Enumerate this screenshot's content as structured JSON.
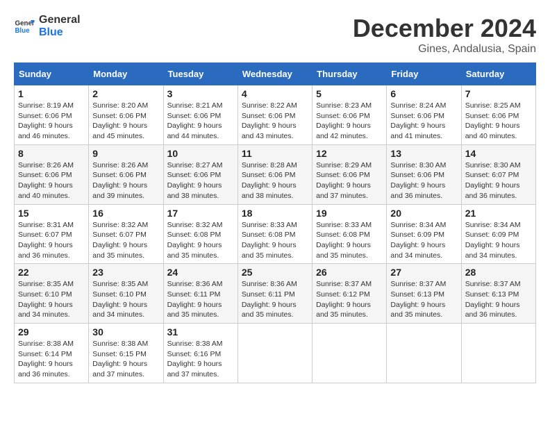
{
  "logo": {
    "line1": "General",
    "line2": "Blue"
  },
  "title": "December 2024",
  "subtitle": "Gines, Andalusia, Spain",
  "days_header": [
    "Sunday",
    "Monday",
    "Tuesday",
    "Wednesday",
    "Thursday",
    "Friday",
    "Saturday"
  ],
  "weeks": [
    [
      {
        "num": "1",
        "info": "Sunrise: 8:19 AM\nSunset: 6:06 PM\nDaylight: 9 hours\nand 46 minutes."
      },
      {
        "num": "2",
        "info": "Sunrise: 8:20 AM\nSunset: 6:06 PM\nDaylight: 9 hours\nand 45 minutes."
      },
      {
        "num": "3",
        "info": "Sunrise: 8:21 AM\nSunset: 6:06 PM\nDaylight: 9 hours\nand 44 minutes."
      },
      {
        "num": "4",
        "info": "Sunrise: 8:22 AM\nSunset: 6:06 PM\nDaylight: 9 hours\nand 43 minutes."
      },
      {
        "num": "5",
        "info": "Sunrise: 8:23 AM\nSunset: 6:06 PM\nDaylight: 9 hours\nand 42 minutes."
      },
      {
        "num": "6",
        "info": "Sunrise: 8:24 AM\nSunset: 6:06 PM\nDaylight: 9 hours\nand 41 minutes."
      },
      {
        "num": "7",
        "info": "Sunrise: 8:25 AM\nSunset: 6:06 PM\nDaylight: 9 hours\nand 40 minutes."
      }
    ],
    [
      {
        "num": "8",
        "info": "Sunrise: 8:26 AM\nSunset: 6:06 PM\nDaylight: 9 hours\nand 40 minutes."
      },
      {
        "num": "9",
        "info": "Sunrise: 8:26 AM\nSunset: 6:06 PM\nDaylight: 9 hours\nand 39 minutes."
      },
      {
        "num": "10",
        "info": "Sunrise: 8:27 AM\nSunset: 6:06 PM\nDaylight: 9 hours\nand 38 minutes."
      },
      {
        "num": "11",
        "info": "Sunrise: 8:28 AM\nSunset: 6:06 PM\nDaylight: 9 hours\nand 38 minutes."
      },
      {
        "num": "12",
        "info": "Sunrise: 8:29 AM\nSunset: 6:06 PM\nDaylight: 9 hours\nand 37 minutes."
      },
      {
        "num": "13",
        "info": "Sunrise: 8:30 AM\nSunset: 6:06 PM\nDaylight: 9 hours\nand 36 minutes."
      },
      {
        "num": "14",
        "info": "Sunrise: 8:30 AM\nSunset: 6:07 PM\nDaylight: 9 hours\nand 36 minutes."
      }
    ],
    [
      {
        "num": "15",
        "info": "Sunrise: 8:31 AM\nSunset: 6:07 PM\nDaylight: 9 hours\nand 36 minutes."
      },
      {
        "num": "16",
        "info": "Sunrise: 8:32 AM\nSunset: 6:07 PM\nDaylight: 9 hours\nand 35 minutes."
      },
      {
        "num": "17",
        "info": "Sunrise: 8:32 AM\nSunset: 6:08 PM\nDaylight: 9 hours\nand 35 minutes."
      },
      {
        "num": "18",
        "info": "Sunrise: 8:33 AM\nSunset: 6:08 PM\nDaylight: 9 hours\nand 35 minutes."
      },
      {
        "num": "19",
        "info": "Sunrise: 8:33 AM\nSunset: 6:08 PM\nDaylight: 9 hours\nand 35 minutes."
      },
      {
        "num": "20",
        "info": "Sunrise: 8:34 AM\nSunset: 6:09 PM\nDaylight: 9 hours\nand 34 minutes."
      },
      {
        "num": "21",
        "info": "Sunrise: 8:34 AM\nSunset: 6:09 PM\nDaylight: 9 hours\nand 34 minutes."
      }
    ],
    [
      {
        "num": "22",
        "info": "Sunrise: 8:35 AM\nSunset: 6:10 PM\nDaylight: 9 hours\nand 34 minutes."
      },
      {
        "num": "23",
        "info": "Sunrise: 8:35 AM\nSunset: 6:10 PM\nDaylight: 9 hours\nand 34 minutes."
      },
      {
        "num": "24",
        "info": "Sunrise: 8:36 AM\nSunset: 6:11 PM\nDaylight: 9 hours\nand 35 minutes."
      },
      {
        "num": "25",
        "info": "Sunrise: 8:36 AM\nSunset: 6:11 PM\nDaylight: 9 hours\nand 35 minutes."
      },
      {
        "num": "26",
        "info": "Sunrise: 8:37 AM\nSunset: 6:12 PM\nDaylight: 9 hours\nand 35 minutes."
      },
      {
        "num": "27",
        "info": "Sunrise: 8:37 AM\nSunset: 6:13 PM\nDaylight: 9 hours\nand 35 minutes."
      },
      {
        "num": "28",
        "info": "Sunrise: 8:37 AM\nSunset: 6:13 PM\nDaylight: 9 hours\nand 36 minutes."
      }
    ],
    [
      {
        "num": "29",
        "info": "Sunrise: 8:38 AM\nSunset: 6:14 PM\nDaylight: 9 hours\nand 36 minutes."
      },
      {
        "num": "30",
        "info": "Sunrise: 8:38 AM\nSunset: 6:15 PM\nDaylight: 9 hours\nand 37 minutes."
      },
      {
        "num": "31",
        "info": "Sunrise: 8:38 AM\nSunset: 6:16 PM\nDaylight: 9 hours\nand 37 minutes."
      },
      {
        "num": "",
        "info": ""
      },
      {
        "num": "",
        "info": ""
      },
      {
        "num": "",
        "info": ""
      },
      {
        "num": "",
        "info": ""
      }
    ]
  ]
}
